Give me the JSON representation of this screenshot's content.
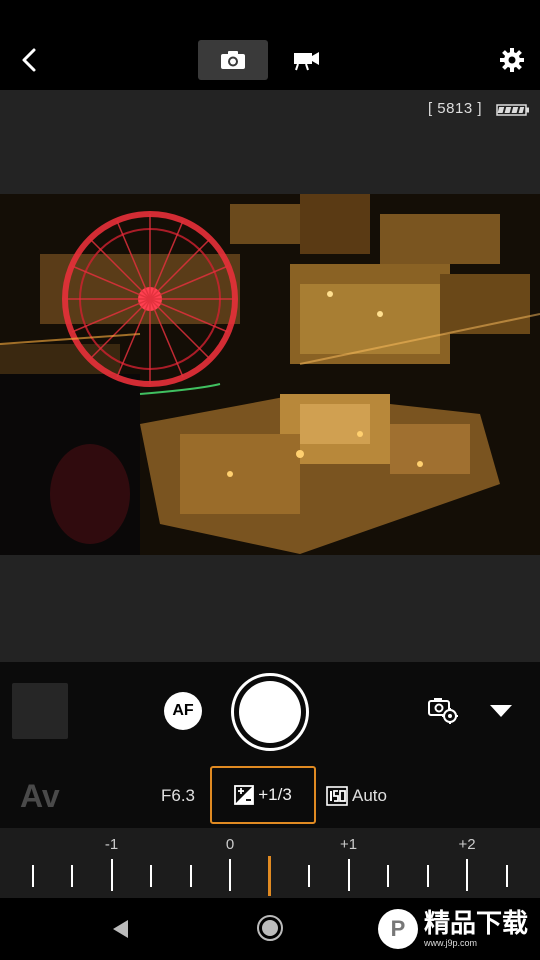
{
  "top_bar": {
    "back_icon": "chevron-left-icon",
    "photo_mode_icon": "camera-icon",
    "video_mode_icon": "movie-camera-icon",
    "settings_icon": "gear-icon",
    "active_mode": "photo"
  },
  "status": {
    "shots_remaining": "[ 5813 ]",
    "battery_icon": "battery-full-icon"
  },
  "controls": {
    "af_label": "AF",
    "shutter_icon": "shutter-button",
    "camera_settings_icon": "camera-gear-icon",
    "dropdown_icon": "triangle-down-icon"
  },
  "exposure": {
    "mode": "Av",
    "aperture": "F6.3",
    "exposure_comp_icon": "exposure-compensation-icon",
    "exposure_comp": "+1/3",
    "iso_icon": "iso-icon",
    "iso": "Auto"
  },
  "ruler": {
    "labels": [
      "-1",
      "0",
      "+1",
      "+2"
    ],
    "current_value": 0.333
  },
  "nav": {
    "back_icon": "triangle-left-icon",
    "home_icon": "circle-home-icon"
  },
  "watermark": {
    "logo": "P",
    "main": "精品下载",
    "sub": "www.j9p.com"
  },
  "colors": {
    "accent": "#e08a22",
    "background": "#000000",
    "panel": "#232323"
  }
}
